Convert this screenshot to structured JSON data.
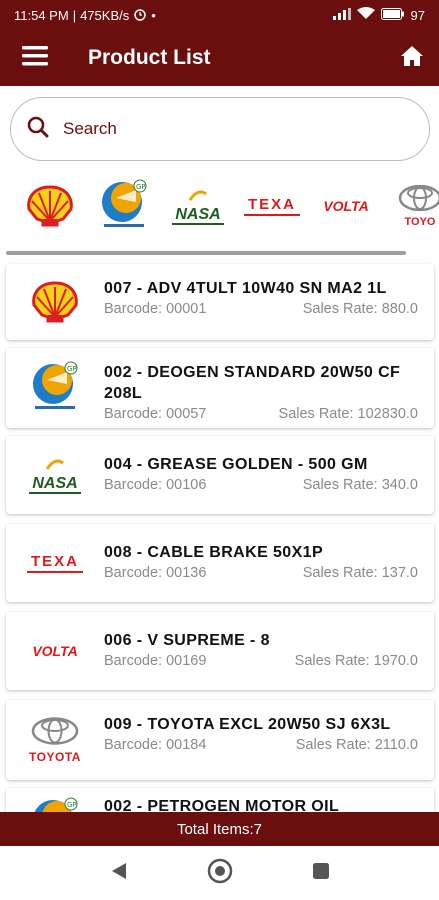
{
  "status_bar": {
    "time": "11:54 PM",
    "speed": "475KB/s",
    "battery": "97"
  },
  "app_bar": {
    "title": "Product List"
  },
  "search": {
    "placeholder": "Search"
  },
  "brands": [
    {
      "name": "shell",
      "label": ""
    },
    {
      "name": "gp-lubricants",
      "label": ""
    },
    {
      "name": "nasa",
      "label": "NASA"
    },
    {
      "name": "texa",
      "label": "TEXA"
    },
    {
      "name": "volta",
      "label": "VOLTA"
    },
    {
      "name": "toyota",
      "label": "TOYO"
    }
  ],
  "products": [
    {
      "brand": "shell",
      "name": "007 - ADV 4TULT 10W40 SN MA2 1L",
      "barcode": "Barcode: 00001",
      "rate": "Sales Rate: 880.0"
    },
    {
      "brand": "gp-lubricants",
      "name": "002 - DEOGEN STANDARD 20W50 CF 208L",
      "barcode": "Barcode: 00057",
      "rate": "Sales Rate: 102830.0"
    },
    {
      "brand": "nasa",
      "name": "004 - GREASE GOLDEN - 500 GM",
      "barcode": "Barcode: 00106",
      "rate": "Sales Rate: 340.0"
    },
    {
      "brand": "texa",
      "name": "008 - CABLE BRAKE 50X1P",
      "barcode": "Barcode: 00136",
      "rate": "Sales Rate: 137.0"
    },
    {
      "brand": "volta",
      "name": "006 - V SUPREME - 8",
      "barcode": "Barcode: 00169",
      "rate": "Sales Rate: 1970.0"
    },
    {
      "brand": "toyota",
      "name": "009 - TOYOTA EXCL 20W50 SJ 6X3L",
      "barcode": "Barcode: 00184",
      "rate": "Sales Rate: 2110.0"
    },
    {
      "brand": "gp-lubricants",
      "name": "002 - PETROGEN MOTOR OIL",
      "barcode": "",
      "rate": ""
    }
  ],
  "footer": {
    "label": "Total Items",
    "count": "7"
  },
  "colors": {
    "primary": "#6b0e0e",
    "muted_text": "#8a8a8a"
  },
  "icons": [
    "menu-icon",
    "home-icon",
    "search-icon",
    "back-icon",
    "home-circle-icon",
    "recents-icon"
  ]
}
